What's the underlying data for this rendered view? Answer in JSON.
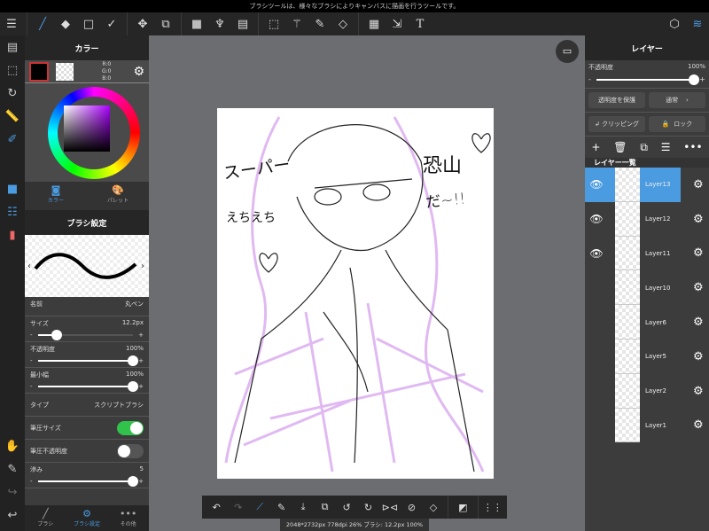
{
  "status_text": "ブラシツールは、様々なブラシによりキャンバスに描画を行うツールです。",
  "toolbar": {
    "icons": [
      "menu-icon",
      "brush-icon",
      "eraser-icon",
      "rectangle-icon",
      "select-vertex-icon",
      "move-icon",
      "transform-icon",
      "fill-color-icon",
      "bucket-icon",
      "gradient-icon",
      "select-rect-icon",
      "magic-wand-icon",
      "select-pen-icon",
      "select-eraser-icon",
      "frame-icon",
      "move-select-icon",
      "text-icon",
      "materials-icon",
      "layers-icon"
    ],
    "text_label": "T"
  },
  "accent": "#4a9be0",
  "color_panel": {
    "title": "カラー",
    "r": "R:0",
    "g": "G:0",
    "b": "B:0",
    "tab_color": "カラー",
    "tab_palette": "パレット"
  },
  "brush_panel": {
    "title": "ブラシ設定",
    "name_label": "名前",
    "name_value": "丸ペン",
    "size_label": "サイズ",
    "size_value": "12.2px",
    "size_fraction": 0.2,
    "opacity_label": "不透明度",
    "opacity_value": "100%",
    "minwidth_label": "最小幅",
    "minwidth_value": "100%",
    "type_label": "タイプ",
    "type_value": "スクリプトブラシ",
    "pressure_size_label": "筆圧サイズ",
    "pressure_size_on": true,
    "pressure_opacity_label": "筆圧不透明度",
    "pressure_opacity_on": false,
    "blur_label": "滲み",
    "blur_value": "5",
    "minus": "-",
    "plus": "+"
  },
  "bottom_tabs": [
    "ブラシ",
    "ブラシ設定",
    "その他"
  ],
  "layer_panel": {
    "title": "レイヤー",
    "opacity_label": "不透明度",
    "opacity_value": "100%",
    "protect_label": "透明度を保護",
    "blend_label": "通常",
    "clipping_label": "クリッピング",
    "lock_label": "ロック",
    "list_title": "レイヤー一覧",
    "layers": [
      {
        "name": "Layer13",
        "visible": true,
        "selected": true
      },
      {
        "name": "Layer12",
        "visible": true
      },
      {
        "name": "Layer11",
        "visible": true
      },
      {
        "name": "Layer10"
      },
      {
        "name": "Layer6"
      },
      {
        "name": "Layer5"
      },
      {
        "name": "Layer2"
      },
      {
        "name": "Layer1"
      }
    ]
  },
  "canvas_info": "2048*2732px 778dpi 26% ブラシ: 12.2px 100%",
  "artwork_text": [
    "スーパー",
    "えちえち",
    "恐山",
    "だ~!!"
  ]
}
